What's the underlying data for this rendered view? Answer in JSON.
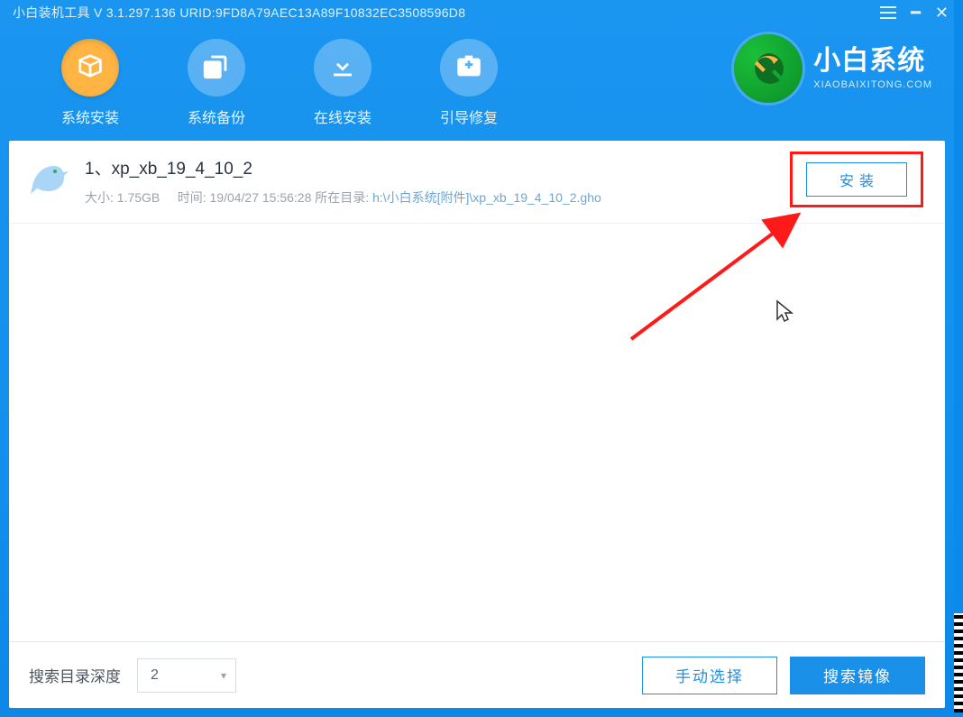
{
  "titlebar": {
    "app_name": "小白装机工具",
    "version_prefix": "V",
    "version": "3.1.297.136",
    "urid_label": "URID:",
    "urid": "9FD8A79AEC13A89F10832EC3508596D8"
  },
  "toolbar": {
    "items": [
      {
        "id": "install",
        "label": "系统安装",
        "icon": "box",
        "active": true
      },
      {
        "id": "backup",
        "label": "系统备份",
        "icon": "copy",
        "active": false
      },
      {
        "id": "online",
        "label": "在线安装",
        "icon": "download",
        "active": false
      },
      {
        "id": "bootfix",
        "label": "引导修复",
        "icon": "firstaid",
        "active": false
      }
    ]
  },
  "brand": {
    "cn": "小白系统",
    "en": "XIAOBAIXITONG.COM"
  },
  "list": {
    "items": [
      {
        "title": "1、xp_xb_19_4_10_2",
        "size_label": "大小:",
        "size": "1.75GB",
        "time_label": "时间:",
        "time": "19/04/27 15:56:28",
        "dir_label": "所在目录:",
        "dir_path": "h:\\小白系统[附件]\\xp_xb_19_4_10_2.gho",
        "button": "安装"
      }
    ]
  },
  "bottombar": {
    "depth_label": "搜索目录深度",
    "depth_value": "2",
    "manual": "手动选择",
    "search": "搜索镜像"
  }
}
